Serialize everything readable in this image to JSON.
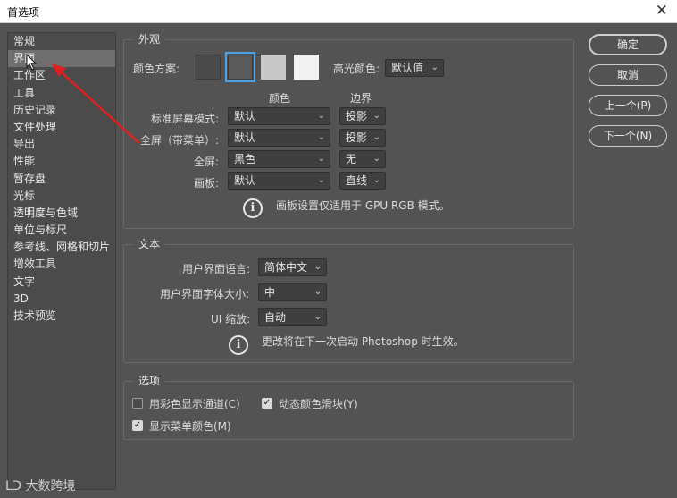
{
  "window": {
    "title": "首选项",
    "close_icon": "close-icon"
  },
  "sidebar": {
    "items": [
      {
        "label": "常规"
      },
      {
        "label": "界面"
      },
      {
        "label": "工作区"
      },
      {
        "label": "工具"
      },
      {
        "label": "历史记录"
      },
      {
        "label": "文件处理"
      },
      {
        "label": "导出"
      },
      {
        "label": "性能"
      },
      {
        "label": "暂存盘"
      },
      {
        "label": "光标"
      },
      {
        "label": "透明度与色域"
      },
      {
        "label": "单位与标尺"
      },
      {
        "label": "参考线、网格和切片"
      },
      {
        "label": "增效工具"
      },
      {
        "label": "文字"
      },
      {
        "label": "3D"
      },
      {
        "label": "技术预览"
      }
    ],
    "active_index": 1
  },
  "appearance": {
    "title": "外观",
    "color_scheme_label": "颜色方案:",
    "swatches": [
      {
        "color": "#4a4a4a",
        "selected": false
      },
      {
        "color": "#5a5a5a",
        "selected": true
      },
      {
        "color": "#c8c8c8",
        "selected": false
      },
      {
        "color": "#f2f2f2",
        "selected": false
      }
    ],
    "highlight_label": "高光颜色:",
    "highlight_value": "默认值",
    "col_color": "颜色",
    "col_border": "边界",
    "rows": [
      {
        "label": "标准屏幕模式:",
        "color": "默认",
        "border": "投影"
      },
      {
        "label": "全屏（带菜单）:",
        "color": "默认",
        "border": "投影"
      },
      {
        "label": "全屏:",
        "color": "黑色",
        "border": "无"
      },
      {
        "label": "画板:",
        "color": "默认",
        "border": "直线"
      }
    ],
    "note": "画板设置仅适用于 GPU RGB 模式。"
  },
  "text_section": {
    "title": "文本",
    "lang_label": "用户界面语言:",
    "lang_value": "简体中文",
    "size_label": "用户界面字体大小:",
    "size_value": "中",
    "scale_label": "UI 缩放:",
    "scale_value": "自动",
    "note": "更改将在下一次启动 Photoshop 时生效。"
  },
  "options": {
    "title": "选项",
    "show_channels_color": {
      "label": "用彩色显示通道(C)",
      "checked": false
    },
    "dynamic_sliders": {
      "label": "动态颜色滑块(Y)",
      "checked": true
    },
    "show_menu_colors": {
      "label": "显示菜单颜色(M)",
      "checked": true
    }
  },
  "buttons": {
    "ok": "确定",
    "cancel": "取消",
    "prev": "上一个(P)",
    "next": "下一个(N)"
  },
  "watermark": "大数跨境"
}
